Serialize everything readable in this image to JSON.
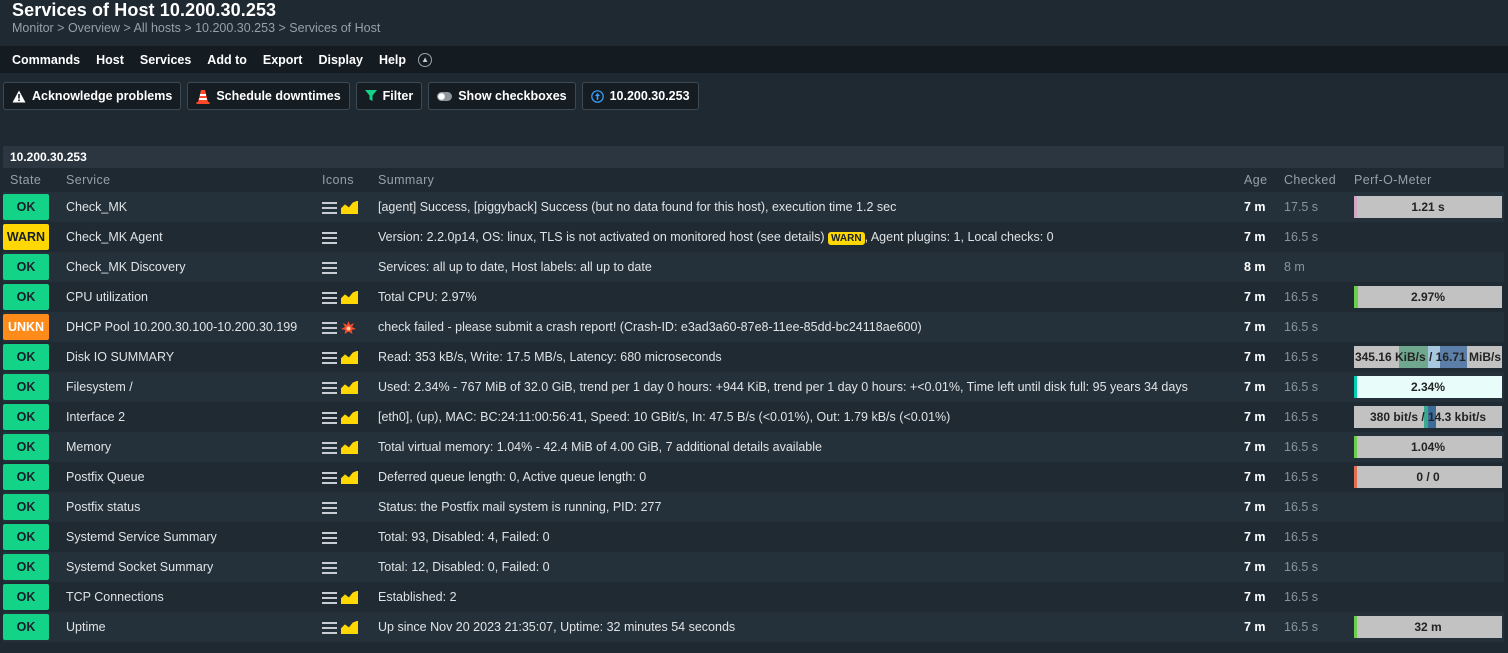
{
  "page": {
    "title": "Services of Host 10.200.30.253",
    "breadcrumb": [
      "Monitor",
      "Overview",
      "All hosts",
      "10.200.30.253",
      "Services of Host"
    ]
  },
  "menu": [
    "Commands",
    "Host",
    "Services",
    "Add to",
    "Export",
    "Display",
    "Help"
  ],
  "toolbar": {
    "acknowledge": "Acknowledge problems",
    "downtimes": "Schedule downtimes",
    "filter": "Filter",
    "checkboxes": "Show checkboxes",
    "host": "10.200.30.253"
  },
  "host_group": "10.200.30.253",
  "columns": {
    "state": "State",
    "service": "Service",
    "icons": "Icons",
    "summary": "Summary",
    "age": "Age",
    "checked": "Checked",
    "perf": "Perf-O-Meter"
  },
  "colors": {
    "ok": "#13d389",
    "warn": "#ffd703",
    "unkn": "#ff8c1a"
  },
  "services": [
    {
      "state": "OK",
      "service": "Check_MK",
      "icons": [
        "menu-icon",
        "graph-icon"
      ],
      "summary": "[agent] Success, [piggyback] Success (but no data found for this host), execution time 1.2 sec",
      "age": "7 m",
      "checked": "17.5 s",
      "perf": "1.21 s",
      "perf_pct": 0.01,
      "perf_color": "#d4a5c4"
    },
    {
      "state": "WARN",
      "service": "Check_MK Agent",
      "icons": [
        "menu-icon"
      ],
      "summary_parts": [
        "Version: 2.2.0p14, OS: linux, TLS is not activated on monitored host (see details)",
        "WARN",
        ", Agent plugins: 1, Local checks: 0"
      ],
      "age": "7 m",
      "checked": "16.5 s",
      "perf": ""
    },
    {
      "state": "OK",
      "service": "Check_MK Discovery",
      "icons": [
        "menu-icon"
      ],
      "summary": "Services: all up to date, Host labels: all up to date",
      "age": "8 m",
      "checked": "8 m",
      "perf": ""
    },
    {
      "state": "OK",
      "service": "CPU utilization",
      "icons": [
        "menu-icon",
        "graph-icon"
      ],
      "summary": "Total CPU: 2.97%",
      "age": "7 m",
      "checked": "16.5 s",
      "perf": "2.97%",
      "perf_pct": 0.0297,
      "perf_color": "#6ad04a"
    },
    {
      "state": "UNKN",
      "service": "DHCP Pool 10.200.30.100-10.200.30.199",
      "icons": [
        "menu-icon",
        "crash-icon"
      ],
      "summary": "check failed - please submit a crash report! (Crash-ID: e3ad3a60-87e8-11ee-85dd-bc24118ae600)",
      "age": "7 m",
      "checked": "16.5 s",
      "perf": ""
    },
    {
      "state": "OK",
      "service": "Disk IO SUMMARY",
      "icons": [
        "menu-icon",
        "graph-icon"
      ],
      "summary": "Read: 353 kB/s, Write: 17.5 MB/s, Latency: 680 microseconds",
      "age": "7 m",
      "checked": "16.5 s",
      "perf": "345.16 KiB/s / 16.71 MiB/s",
      "perf_type": "diskio"
    },
    {
      "state": "OK",
      "service": "Filesystem /",
      "icons": [
        "menu-icon",
        "graph-icon"
      ],
      "summary": "Used: 2.34% - 767 MiB of 32.0 GiB, trend per 1 day 0 hours: +944 KiB, trend per 1 day 0 hours: +<0.01%, Time left until disk full: 95 years 34 days",
      "age": "7 m",
      "checked": "16.5 s",
      "perf": "2.34%",
      "perf_pct": 0.0234,
      "perf_color": "#00d0b0",
      "perf_bg": "#e8fdfa"
    },
    {
      "state": "OK",
      "service": "Interface 2",
      "icons": [
        "menu-icon",
        "graph-icon"
      ],
      "summary": "[eth0], (up), MAC: BC:24:11:00:56:41, Speed: 10 GBit/s, In: 47.5 B/s (<0.01%), Out: 1.79 kB/s (<0.01%)",
      "age": "7 m",
      "checked": "16.5 s",
      "perf": "380 bit/s / 14.3 kbit/s",
      "perf_type": "iface"
    },
    {
      "state": "OK",
      "service": "Memory",
      "icons": [
        "menu-icon",
        "graph-icon"
      ],
      "summary": "Total virtual memory: 1.04% - 42.4 MiB of 4.00 GiB, 7 additional details available",
      "age": "7 m",
      "checked": "16.5 s",
      "perf": "1.04%",
      "perf_pct": 0.0104,
      "perf_color": "#6ad04a"
    },
    {
      "state": "OK",
      "service": "Postfix Queue",
      "icons": [
        "menu-icon",
        "graph-icon"
      ],
      "summary": "Deferred queue length: 0, Active queue length: 0",
      "age": "7 m",
      "checked": "16.5 s",
      "perf": "0 / 0",
      "perf_pct": 0.005,
      "perf_color": "#e07050"
    },
    {
      "state": "OK",
      "service": "Postfix status",
      "icons": [
        "menu-icon"
      ],
      "summary": "Status: the Postfix mail system is running, PID: 277",
      "age": "7 m",
      "checked": "16.5 s",
      "perf": ""
    },
    {
      "state": "OK",
      "service": "Systemd Service Summary",
      "icons": [
        "menu-icon"
      ],
      "summary": "Total: 93, Disabled: 4, Failed: 0",
      "age": "7 m",
      "checked": "16.5 s",
      "perf": ""
    },
    {
      "state": "OK",
      "service": "Systemd Socket Summary",
      "icons": [
        "menu-icon"
      ],
      "summary": "Total: 12, Disabled: 0, Failed: 0",
      "age": "7 m",
      "checked": "16.5 s",
      "perf": ""
    },
    {
      "state": "OK",
      "service": "TCP Connections",
      "icons": [
        "menu-icon",
        "graph-icon"
      ],
      "summary": "Established: 2",
      "age": "7 m",
      "checked": "16.5 s",
      "perf": ""
    },
    {
      "state": "OK",
      "service": "Uptime",
      "icons": [
        "menu-icon",
        "graph-icon"
      ],
      "summary": "Up since Nov 20 2023 21:35:07, Uptime: 32 minutes 54 seconds",
      "age": "7 m",
      "checked": "16.5 s",
      "perf": "32 m",
      "perf_pct": 0.01,
      "perf_color": "#6ad04a"
    }
  ]
}
